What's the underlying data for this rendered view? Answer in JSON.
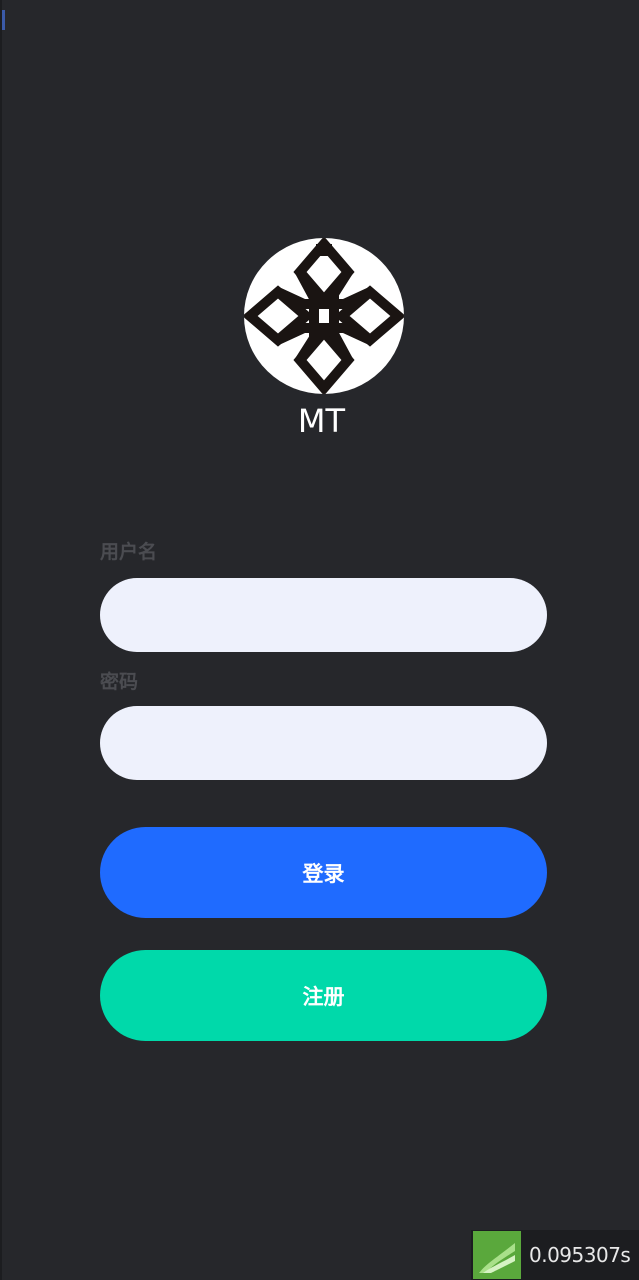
{
  "brand": {
    "name": "MT"
  },
  "form": {
    "username_label": "用户名",
    "username_value": "",
    "password_label": "密码",
    "password_value": ""
  },
  "buttons": {
    "login_label": "登录",
    "register_label": "注册"
  },
  "colors": {
    "background": "#26272b",
    "input_bg": "#eef1fc",
    "login": "#1f6bff",
    "register": "#00d9aa",
    "label": "#4b4c51"
  },
  "perf": {
    "icon": "perf-monitor-icon",
    "time": "0.095307s"
  }
}
